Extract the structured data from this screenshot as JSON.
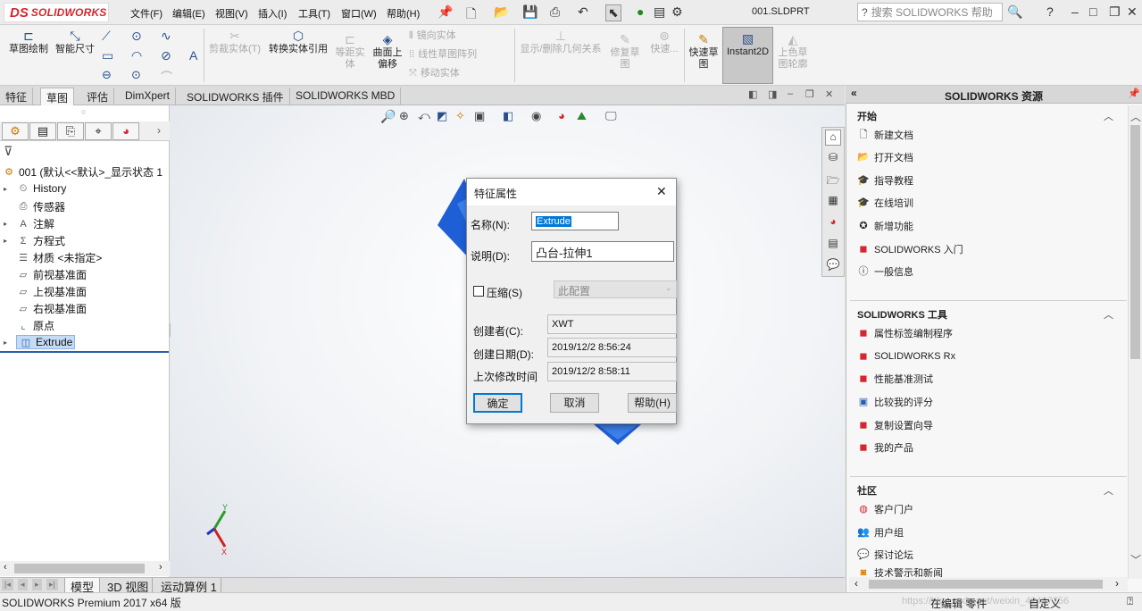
{
  "app": {
    "logo_brand": "DS",
    "logo_text": "SOLIDWORKS",
    "filename": "001.SLDPRT",
    "help_search_placeholder": "搜索 SOLIDWORKS 帮助"
  },
  "menu": [
    "文件(F)",
    "编辑(E)",
    "视图(V)",
    "插入(I)",
    "工具(T)",
    "窗口(W)",
    "帮助(H)"
  ],
  "commands": {
    "sketch": "草图绘制",
    "smart_dim": "智能尺寸",
    "trim": "剪裁实体(T)",
    "convert": "转换实体引用",
    "offset": "等距实\n体",
    "surface_offset": "曲面上\n偏移",
    "mirror": "镜向实体",
    "linear_pattern": "线性草图阵列",
    "move": "移动实体",
    "show_delete": "显示/删除几何关系",
    "repair": "修复草\n图",
    "quick_snap": "快速...",
    "rapid_sketch": "快速草\n图",
    "instant2d": "Instant2D",
    "shaded_contours": "上色草\n图轮廓"
  },
  "tabs": [
    "特征",
    "草图",
    "评估",
    "DimXpert",
    "SOLIDWORKS 插件",
    "SOLIDWORKS MBD"
  ],
  "active_tab": "草图",
  "tree": {
    "root": "001 (默认<<默认>_显示状态 1",
    "items": [
      "History",
      "传感器",
      "注解",
      "方程式",
      "材质 <未指定>",
      "前视基准面",
      "上视基准面",
      "右视基准面",
      "原点",
      "Extrude"
    ]
  },
  "bottom_tabs": [
    "模型",
    "3D 视图",
    "运动算例 1"
  ],
  "status": {
    "left": "SOLIDWORKS Premium 2017 x64 版",
    "editing": "在编辑 零件",
    "custom": "自定义"
  },
  "taskpane": {
    "title": "SOLIDWORKS 资源",
    "sections": [
      {
        "title": "开始",
        "links": [
          "新建文档",
          "打开文档",
          "指导教程",
          "在线培训",
          "新增功能",
          "SOLIDWORKS 入门",
          "一般信息"
        ]
      },
      {
        "title": "SOLIDWORKS 工具",
        "links": [
          "属性标签编制程序",
          "SOLIDWORKS Rx",
          "性能基准测试",
          "比较我的评分",
          "复制设置向导",
          "我的产品"
        ]
      },
      {
        "title": "社区",
        "links": [
          "客户门户",
          "用户组",
          "探讨论坛",
          "技术警示和新闻"
        ]
      }
    ]
  },
  "dialog": {
    "title": "特征属性",
    "name_label": "名称(N):",
    "name_value": "Extrude",
    "desc_label": "说明(D):",
    "desc_value": "凸台-拉伸1",
    "suppress_label": "压缩(S)",
    "config_value": "此配置",
    "created_by_label": "创建者(C):",
    "created_by_value": "XWT",
    "created_date_label": "创建日期(D):",
    "created_date_value": "2019/12/2 8:56:24",
    "modified_label": "上次修改时间",
    "modified_value": "2019/12/2 8:58:11",
    "ok": "确定",
    "cancel": "取消",
    "help": "帮助(H)"
  },
  "triad": {
    "y": "Y",
    "x": "X"
  },
  "watermark": "https://blog.csdn.net/weixin_42437756",
  "colors": {
    "accent_red": "#d6262d",
    "part_blue": "#1f5fd6",
    "selection": "#c5dcf5"
  }
}
